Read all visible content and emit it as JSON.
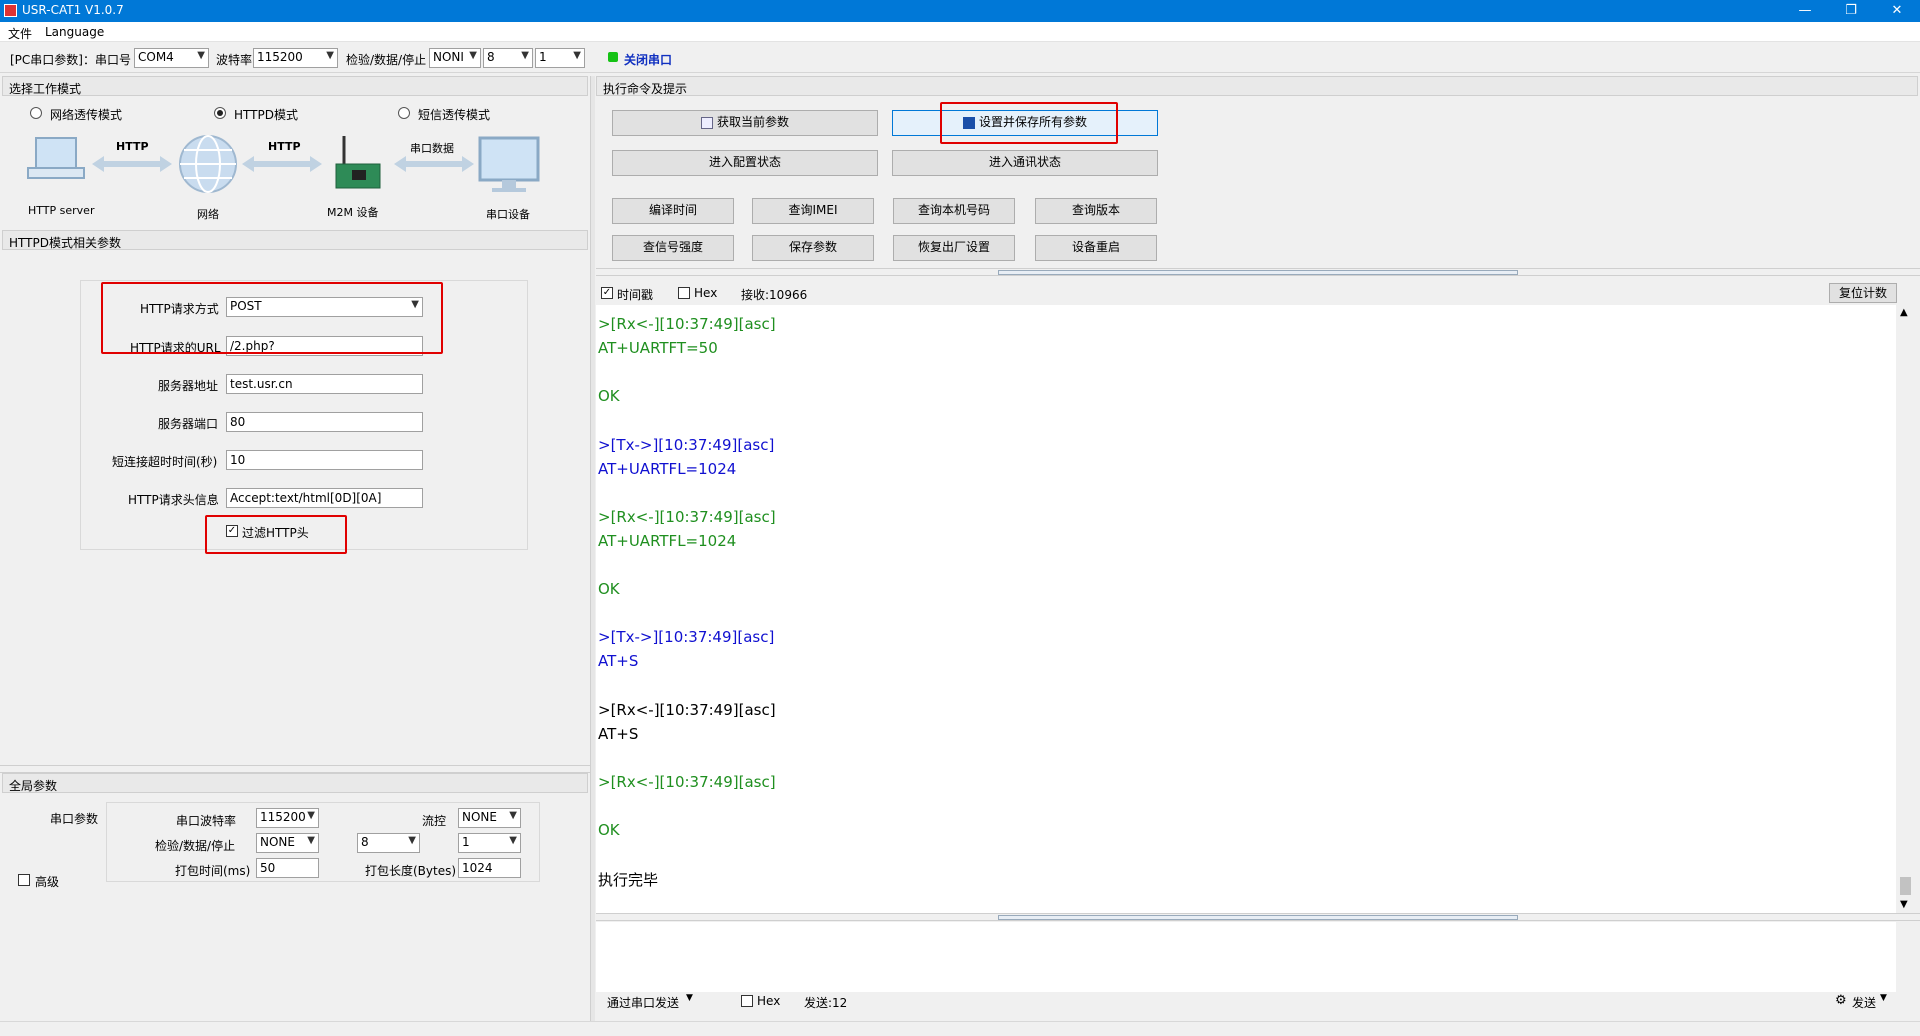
{
  "window": {
    "title": "USR-CAT1 V1.0.7"
  },
  "menu": [
    "文件",
    "Language"
  ],
  "toolbar": {
    "pc_serial_label": "[PC串口参数]：串口号",
    "port": "COM4",
    "baud_label": "波特率",
    "baud": "115200",
    "check_label": "检验/数据/停止",
    "parity": "NONI",
    "databits": "8",
    "stopbits": "1",
    "close_port": "关闭串口"
  },
  "work_mode": {
    "header": "选择工作模式",
    "options": [
      "网络透传模式",
      "HTTPD模式",
      "短信透传模式"
    ],
    "selected": "HTTPD模式",
    "diagram": {
      "nodes": [
        "HTTP server",
        "网络",
        "M2M 设备",
        "串口设备"
      ],
      "arrows": [
        "HTTP",
        "HTTP",
        "串口数据"
      ]
    }
  },
  "httpd": {
    "header": "HTTPD模式相关参数",
    "method_label": "HTTP请求方式",
    "method": "POST",
    "url_label": "HTTP请求的URL",
    "url": "/2.php?",
    "server_label": "服务器地址",
    "server": "test.usr.cn",
    "port_label": "服务器端口",
    "port": "80",
    "timeout_label": "短连接超时时间(秒)",
    "timeout": "10",
    "header_label": "HTTP请求头信息",
    "header_value": "Accept:text/html[0D][0A]",
    "filter_label": "过滤HTTP头",
    "filter_checked": true
  },
  "global": {
    "header": "全局参数",
    "serial_label": "串口参数",
    "baud_label": "串口波特率",
    "baud": "115200",
    "flow_label": "流控",
    "flow": "NONE",
    "check_label": "检验/数据/停止",
    "parity": "NONE",
    "databits": "8",
    "stopbits": "1",
    "pack_time_label": "打包时间(ms)",
    "pack_time": "50",
    "pack_len_label": "打包长度(Bytes)",
    "pack_len": "1024",
    "advanced_label": "高级"
  },
  "commands": {
    "header": "执行命令及提示",
    "get_params": "获取当前参数",
    "save_all": "设置并保存所有参数",
    "enter_config": "进入配置状态",
    "enter_comm": "进入通讯状态",
    "buttons": [
      "编译时间",
      "查询IMEI",
      "查询本机号码",
      "查询版本",
      "查信号强度",
      "保存参数",
      "恢复出厂设置",
      "设备重启"
    ]
  },
  "console": {
    "timestamp_label": "时间戳",
    "hex_label": "Hex",
    "recv_label": "接收:10966",
    "reset_count": "复位计数",
    "lines": [
      {
        "t": ">[Rx<-][10:37:49][asc]",
        "c": "rx"
      },
      {
        "t": "AT+UARTFT=50",
        "c": "rx"
      },
      {
        "t": "",
        "c": "rx"
      },
      {
        "t": "OK",
        "c": "rx"
      },
      {
        "t": "",
        "c": "rx"
      },
      {
        "t": ">[Tx->][10:37:49][asc]",
        "c": "tx"
      },
      {
        "t": "AT+UARTFL=1024",
        "c": "tx"
      },
      {
        "t": "",
        "c": "tx"
      },
      {
        "t": ">[Rx<-][10:37:49][asc]",
        "c": "rx"
      },
      {
        "t": "AT+UARTFL=1024",
        "c": "rx"
      },
      {
        "t": "",
        "c": "rx"
      },
      {
        "t": "OK",
        "c": "rx"
      },
      {
        "t": "",
        "c": "rx"
      },
      {
        "t": ">[Tx->][10:37:49][asc]",
        "c": "tx"
      },
      {
        "t": "AT+S",
        "c": "tx"
      },
      {
        "t": "",
        "c": "bk"
      },
      {
        "t": ">[Rx<-][10:37:49][asc]",
        "c": "bk"
      },
      {
        "t": "AT+S",
        "c": "bk"
      },
      {
        "t": "",
        "c": "rx"
      },
      {
        "t": ">[Rx<-][10:37:49][asc]",
        "c": "rx"
      },
      {
        "t": "",
        "c": "rx"
      },
      {
        "t": "OK",
        "c": "rx"
      },
      {
        "t": "",
        "c": "bk"
      },
      {
        "t": "执行完毕",
        "c": "bk"
      }
    ]
  },
  "send": {
    "via_label": "通过串口发送",
    "hex_label": "Hex",
    "sent_label": "发送:12",
    "send_button": "发送"
  },
  "colors": {
    "titlebar": "#0078d7",
    "rx": "#1f8f1f",
    "tx": "#1010d0",
    "highlight": "#e00000"
  }
}
